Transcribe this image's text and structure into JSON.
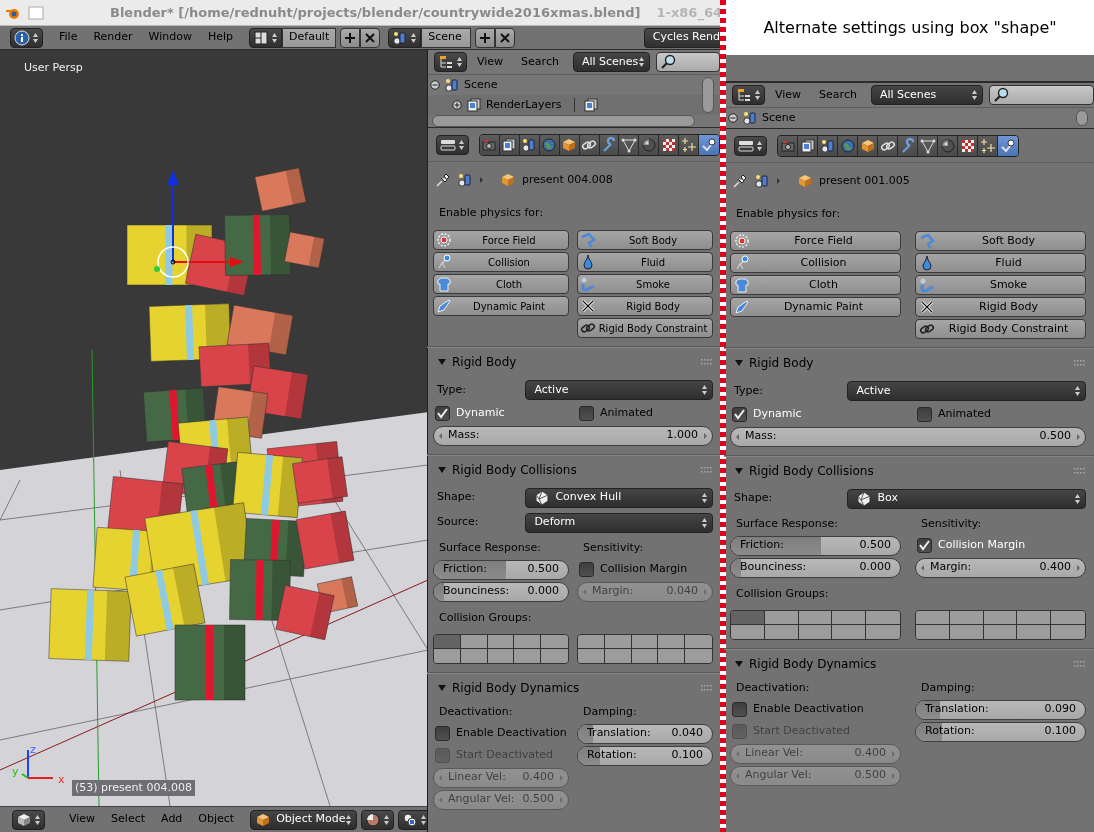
{
  "title_bar": {
    "title": "Blender* [/home/rednuht/projects/blender/countrywide2016xmas.blend]",
    "background_fragment": "1-x86_64"
  },
  "main_menu": [
    "File",
    "Render",
    "Window",
    "Help"
  ],
  "screen_layout": "Default",
  "scene_selector": "Scene",
  "render_engine": "Cycles Rend",
  "viewport": {
    "view_name": "User Persp",
    "object_info": "(53) present 004.008",
    "axes": [
      "z",
      "y",
      "x"
    ],
    "menus": [
      "View",
      "Select",
      "Add",
      "Object"
    ],
    "mode": "Object Mode"
  },
  "outliner": {
    "menus": [
      "View",
      "Search"
    ],
    "filter": "All Scenes",
    "tree": [
      {
        "label": "Scene",
        "expanded": true,
        "children": [
          {
            "label": "RenderLayers",
            "expanded": false
          }
        ]
      }
    ]
  },
  "properties": {
    "tabs": [
      {
        "selected": false
      },
      {
        "selected": false
      },
      {
        "selected": false
      },
      {
        "selected": false
      },
      {
        "selected": false
      },
      {
        "selected": false
      },
      {
        "selected": false
      },
      {
        "selected": false
      },
      {
        "selected": false
      },
      {
        "selected": false
      },
      {
        "selected": false
      },
      {
        "selected": true
      }
    ],
    "object_name": "present 004.008",
    "physics_heading": "Enable physics for:",
    "physics_buttons": [
      {
        "label": "Force Field"
      },
      {
        "label": "Soft Body"
      },
      {
        "label": "Collision"
      },
      {
        "label": "Fluid"
      },
      {
        "label": "Cloth"
      },
      {
        "label": "Smoke"
      },
      {
        "label": "Dynamic Paint"
      },
      {
        "label": "Rigid Body"
      },
      {
        "label": "Rigid Body Constraint"
      }
    ],
    "rigid_body": {
      "title": "Rigid Body",
      "expanded": true,
      "type": {
        "label": "Type:",
        "value": "Active"
      },
      "dynamic": {
        "label": "Dynamic",
        "checked": true
      },
      "animated": {
        "label": "Animated",
        "checked": false
      },
      "mass": {
        "label": "Mass:",
        "value": "1.000"
      }
    },
    "collisions": {
      "title": "Rigid Body Collisions",
      "expanded": true,
      "shape": {
        "label": "Shape:",
        "value": "Convex Hull"
      },
      "source": {
        "label": "Source:",
        "value": "Deform"
      },
      "surface_heading": "Surface Response:",
      "friction": {
        "label": "Friction:",
        "value": "0.500",
        "level": 0.5
      },
      "bounciness": {
        "label": "Bounciness:",
        "value": "0.000",
        "level": 0.0
      },
      "sensitivity_heading": "Sensitivity:",
      "collision_margin": {
        "label": "Collision Margin",
        "checked": false
      },
      "margin": {
        "label": "Margin:",
        "value": "0.040",
        "disabled": true
      },
      "groups_heading": "Collision Groups:",
      "groups": [
        {
          "selected": true
        },
        {
          "selected": false
        },
        {
          "selected": false
        },
        {
          "selected": false
        },
        {
          "selected": false
        },
        {
          "selected": false
        },
        {
          "selected": false
        },
        {
          "selected": false
        },
        {
          "selected": false
        },
        {
          "selected": false
        },
        {
          "selected": false
        },
        {
          "selected": false
        },
        {
          "selected": false
        },
        {
          "selected": false
        },
        {
          "selected": false
        },
        {
          "selected": false
        },
        {
          "selected": false
        },
        {
          "selected": false
        },
        {
          "selected": false
        },
        {
          "selected": false
        }
      ]
    },
    "dynamics": {
      "title": "Rigid Body Dynamics",
      "expanded": true,
      "deactivation_heading": "Deactivation:",
      "enable_deactivation": {
        "label": "Enable Deactivation",
        "checked": false
      },
      "start_deactivated": {
        "label": "Start Deactivated",
        "checked": false,
        "disabled": true
      },
      "linear_vel": {
        "label": "Linear Vel:",
        "value": "0.400",
        "disabled": true
      },
      "angular_vel": {
        "label": "Angular Vel:",
        "value": "0.500",
        "disabled": true
      },
      "damping_heading": "Damping:",
      "translation": {
        "label": "Translation:",
        "value": "0.040",
        "level": 0.04
      },
      "rotation": {
        "label": "Rotation:",
        "value": "0.100",
        "level": 0.1
      }
    }
  },
  "caption": "Alternate settings using box \"shape\"",
  "alternate": {
    "outliner": {
      "menus": [
        "View",
        "Search"
      ],
      "filter": "All Scenes",
      "tree": [
        {
          "label": "Scene",
          "expanded": true
        }
      ]
    },
    "properties": {
      "tabs": [
        {
          "selected": false
        },
        {
          "selected": false
        },
        {
          "selected": false
        },
        {
          "selected": false
        },
        {
          "selected": false
        },
        {
          "selected": false
        },
        {
          "selected": false
        },
        {
          "selected": false
        },
        {
          "selected": false
        },
        {
          "selected": false
        },
        {
          "selected": false
        },
        {
          "selected": true
        }
      ],
      "object_name": "present 001.005",
      "physics_heading": "Enable physics for:",
      "physics_buttons": [
        {
          "label": "Force Field"
        },
        {
          "label": "Soft Body"
        },
        {
          "label": "Collision"
        },
        {
          "label": "Fluid"
        },
        {
          "label": "Cloth"
        },
        {
          "label": "Smoke"
        },
        {
          "label": "Dynamic Paint"
        },
        {
          "label": "Rigid Body"
        },
        {
          "label": "Rigid Body Constraint"
        }
      ],
      "rigid_body": {
        "title": "Rigid Body",
        "expanded": true,
        "type": {
          "label": "Type:",
          "value": "Active"
        },
        "dynamic": {
          "label": "Dynamic",
          "checked": true
        },
        "animated": {
          "label": "Animated",
          "checked": false
        },
        "mass": {
          "label": "Mass:",
          "value": "0.500"
        }
      },
      "collisions": {
        "title": "Rigid Body Collisions",
        "expanded": true,
        "shape": {
          "label": "Shape:",
          "value": "Box"
        },
        "surface_heading": "Surface Response:",
        "friction": {
          "label": "Friction:",
          "value": "0.500",
          "level": 0.5
        },
        "bounciness": {
          "label": "Bounciness:",
          "value": "0.000",
          "level": 0.0
        },
        "sensitivity_heading": "Sensitivity:",
        "collision_margin": {
          "label": "Collision Margin",
          "checked": true
        },
        "margin": {
          "label": "Margin:",
          "value": "0.400",
          "disabled": false
        },
        "groups_heading": "Collision Groups:",
        "groups": [
          {
            "selected": true
          },
          {
            "selected": false
          },
          {
            "selected": false
          },
          {
            "selected": false
          },
          {
            "selected": false
          },
          {
            "selected": false
          },
          {
            "selected": false
          },
          {
            "selected": false
          },
          {
            "selected": false
          },
          {
            "selected": false
          },
          {
            "selected": false
          },
          {
            "selected": false
          },
          {
            "selected": false
          },
          {
            "selected": false
          },
          {
            "selected": false
          },
          {
            "selected": false
          },
          {
            "selected": false
          },
          {
            "selected": false
          },
          {
            "selected": false
          },
          {
            "selected": false
          }
        ]
      },
      "dynamics": {
        "title": "Rigid Body Dynamics",
        "expanded": true,
        "deactivation_heading": "Deactivation:",
        "enable_deactivation": {
          "label": "Enable Deactivation",
          "checked": false
        },
        "start_deactivated": {
          "label": "Start Deactivated",
          "checked": false,
          "disabled": true
        },
        "linear_vel": {
          "label": "Linear Vel:",
          "value": "0.400",
          "disabled": true
        },
        "angular_vel": {
          "label": "Angular Vel:",
          "value": "0.500",
          "disabled": true
        },
        "damping_heading": "Damping:",
        "translation": {
          "label": "Translation:",
          "value": "0.090",
          "level": 0.09
        },
        "rotation": {
          "label": "Rotation:",
          "value": "0.100",
          "level": 0.1
        }
      }
    }
  }
}
